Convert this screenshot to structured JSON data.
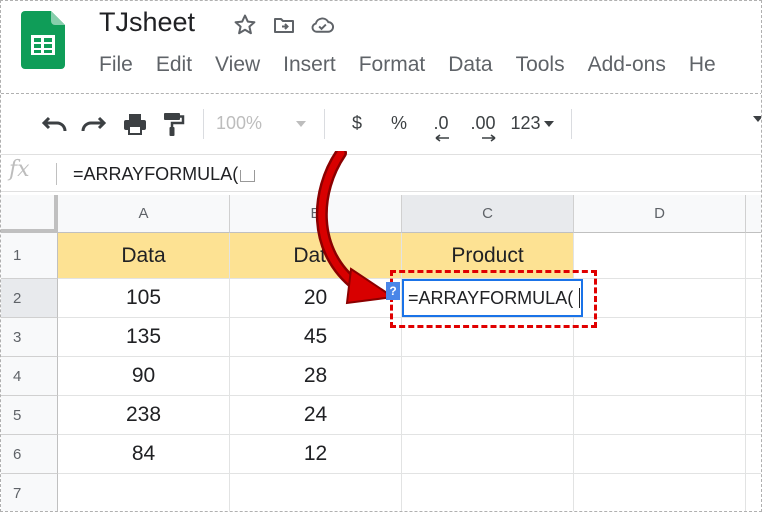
{
  "app": {
    "doc_title": "TJsheet"
  },
  "menu": [
    "File",
    "Edit",
    "View",
    "Insert",
    "Format",
    "Data",
    "Tools",
    "Add-ons",
    "He"
  ],
  "toolbar": {
    "zoom": "100%",
    "currency": "$",
    "percent": "%",
    "decrease_decimal": ".0",
    "increase_decimal": ".00",
    "more_formats": "123"
  },
  "formula_bar": {
    "fx_label": "fx",
    "content": "=ARRAYFORMULA("
  },
  "sheet": {
    "columns": [
      "A",
      "B",
      "C",
      "D"
    ],
    "rows": [
      "1",
      "2",
      "3",
      "4",
      "5",
      "6",
      "7"
    ],
    "header": [
      "Data",
      "Data",
      "Product"
    ],
    "data": [
      [
        "105",
        "20"
      ],
      [
        "135",
        "45"
      ],
      [
        "90",
        "28"
      ],
      [
        "238",
        "24"
      ],
      [
        "84",
        "12"
      ]
    ]
  },
  "editor": {
    "content": "=ARRAYFORMULA(",
    "help_chip": "?"
  },
  "colors": {
    "header_fill": "#fde293",
    "selection_blue": "#1a73e8",
    "annotation_red": "#e00000",
    "sheets_green": "#0f9d58"
  }
}
